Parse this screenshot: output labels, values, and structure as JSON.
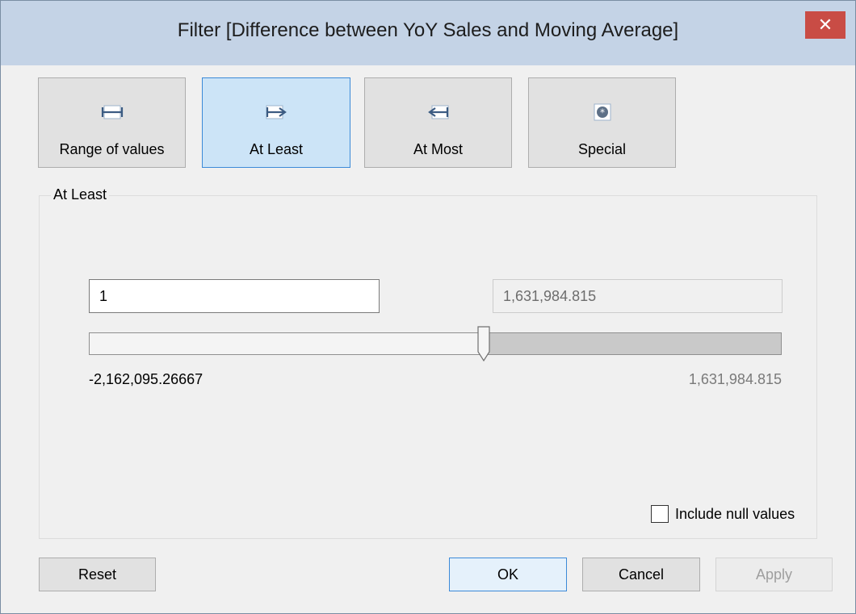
{
  "window": {
    "title": "Filter [Difference between YoY Sales and Moving Average]",
    "close_glyph": "✕"
  },
  "mode_tabs": [
    {
      "label": "Range of values",
      "icon": "range-icon",
      "active": false
    },
    {
      "label": "At Least",
      "icon": "at-least-icon",
      "active": true
    },
    {
      "label": "At Most",
      "icon": "at-most-icon",
      "active": false
    },
    {
      "label": "Special",
      "icon": "special-icon",
      "active": false
    }
  ],
  "group": {
    "legend": "At Least"
  },
  "range": {
    "from_value": "1",
    "to_value": "1,631,984.815",
    "min_label": "-2,162,095.26667",
    "max_label": "1,631,984.815",
    "thumb_fraction": 0.5698
  },
  "include_null": {
    "label": "Include null values",
    "checked": false
  },
  "buttons": {
    "reset": "Reset",
    "ok": "OK",
    "cancel": "Cancel",
    "apply": "Apply"
  },
  "colors": {
    "accent": "#3c8ad8",
    "active_tab_bg": "#cce4f7",
    "close_red": "#c94c45",
    "titlebar": "#c4d3e6"
  }
}
